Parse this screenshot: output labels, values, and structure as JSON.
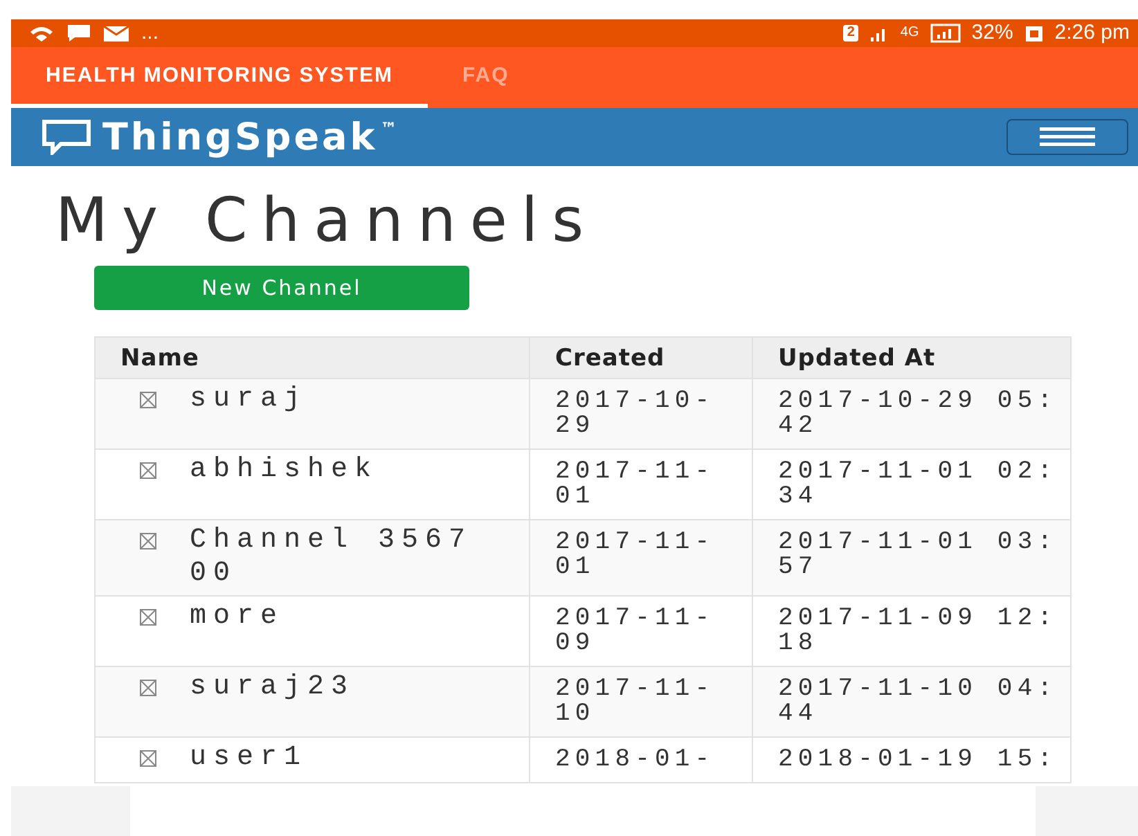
{
  "status_bar": {
    "overflow": "...",
    "sim_slot": "2",
    "network": "4G",
    "battery": "32%",
    "time": "2:26 pm"
  },
  "app_bar": {
    "tabs": [
      {
        "label": "HEALTH MONITORING SYSTEM",
        "selected": true
      },
      {
        "label": "FAQ",
        "selected": false
      }
    ]
  },
  "navbar": {
    "brand": "ThingSpeak",
    "trademark": "™"
  },
  "page": {
    "title": "My Channels",
    "new_button": "New Channel"
  },
  "table": {
    "columns": [
      "Name",
      "Created",
      "Updated At"
    ],
    "rows": [
      {
        "name": "suraj",
        "created": "2017-10-29",
        "updated": "2017-10-29 05:42"
      },
      {
        "name": "abhishek",
        "created": "2017-11-01",
        "updated": "2017-11-01 02:34"
      },
      {
        "name": "Channel 356700",
        "created": "2017-11-01",
        "updated": "2017-11-01 03:57"
      },
      {
        "name": "more",
        "created": "2017-11-09",
        "updated": "2017-11-09 12:18"
      },
      {
        "name": "suraj23",
        "created": "2017-11-10",
        "updated": "2017-11-10 04:44"
      },
      {
        "name": "user1",
        "created": "2018-01-",
        "updated": "2018-01-19 15:"
      }
    ]
  }
}
